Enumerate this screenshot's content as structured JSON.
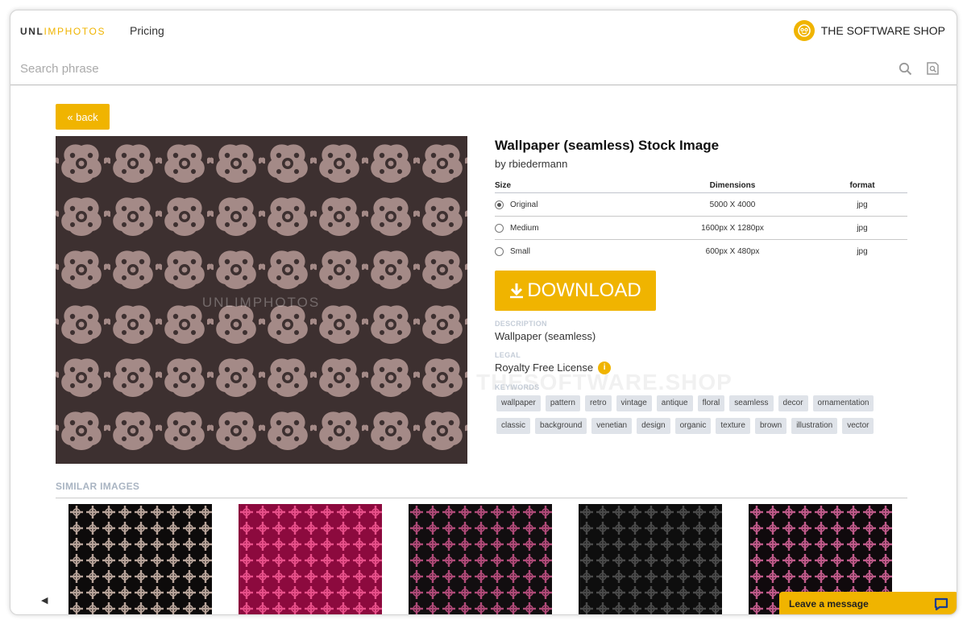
{
  "header": {
    "logo": {
      "part1": "UNL",
      "part2": "I",
      "part3": "MPHOTOS"
    },
    "nav_pricing": "Pricing",
    "brand": "THE SOFTWARE SHOP"
  },
  "search": {
    "placeholder": "Search phrase"
  },
  "back_label": "« back",
  "preview": {
    "watermark": "UNLIMPHOTOS",
    "background": "#3d3030",
    "motif": "#a48a87"
  },
  "image": {
    "title": "Wallpaper (seamless) Stock Image",
    "author": "by rbiedermann",
    "size_headers": {
      "size": "Size",
      "dimensions": "Dimensions",
      "format": "format"
    },
    "sizes": [
      {
        "label": "Original",
        "dimensions": "5000 X 4000",
        "format": "jpg",
        "selected": true
      },
      {
        "label": "Medium",
        "dimensions": "1600px X 1280px",
        "format": "jpg",
        "selected": false
      },
      {
        "label": "Small",
        "dimensions": "600px X 480px",
        "format": "jpg",
        "selected": false
      }
    ],
    "download_label": "DOWNLOAD",
    "description_label": "DESCRIPTION",
    "description": "Wallpaper (seamless)",
    "legal_label": "LEGAL",
    "license": "Royalty Free License",
    "keywords_label": "KEYWORDS",
    "keywords": [
      "wallpaper",
      "pattern",
      "retro",
      "vintage",
      "antique",
      "floral",
      "seamless",
      "decor",
      "ornamentation",
      "classic",
      "background",
      "venetian",
      "design",
      "organic",
      "texture",
      "brown",
      "illustration",
      "vector"
    ]
  },
  "page_watermark": "THESOFTWARE.SHOP",
  "similar": {
    "label": "SIMILAR IMAGES",
    "thumbs": [
      {
        "bg": "#0d0b0b",
        "motif": "#b8a49a"
      },
      {
        "bg": "#8c0a3e",
        "motif": "#e8508a"
      },
      {
        "bg": "#120e10",
        "motif": "#b04a78"
      },
      {
        "bg": "#0e0e0e",
        "motif": "#4a4a4a"
      },
      {
        "bg": "#100a0d",
        "motif": "#c05a8a"
      }
    ]
  },
  "chat": {
    "label": "Leave a message"
  },
  "colors": {
    "accent": "#f0b400"
  }
}
